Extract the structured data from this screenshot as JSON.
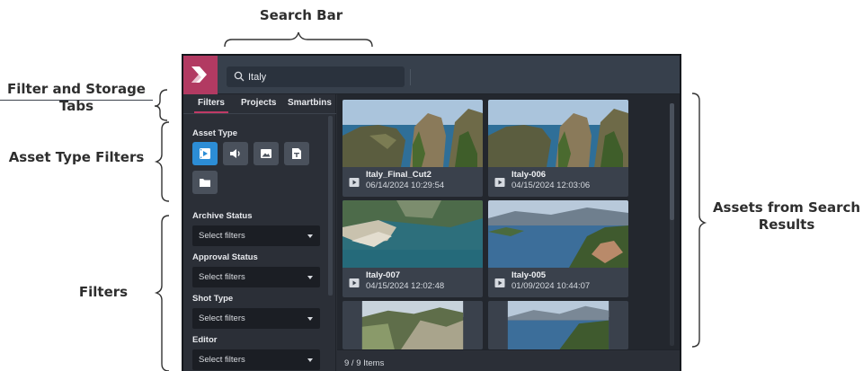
{
  "annotations": {
    "search_bar": "Search Bar",
    "filter_tabs": "Filter and Storage Tabs",
    "asset_type_filters": "Asset Type Filters",
    "filters": "Filters",
    "assets": "Assets from Search Results"
  },
  "search": {
    "value": "Italy",
    "icon": "search-icon"
  },
  "tabs": [
    {
      "label": "Filters",
      "active": true
    },
    {
      "label": "Projects",
      "active": false
    },
    {
      "label": "Smartbins",
      "active": false
    }
  ],
  "sidebar": {
    "asset_type_label": "Asset Type",
    "asset_types": [
      {
        "icon": "video-icon",
        "active": true
      },
      {
        "icon": "audio-icon",
        "active": false
      },
      {
        "icon": "image-icon",
        "active": false
      },
      {
        "icon": "document-icon",
        "active": false
      },
      {
        "icon": "folder-icon",
        "active": false
      }
    ],
    "filters": [
      {
        "label": "Archive Status",
        "placeholder": "Select filters"
      },
      {
        "label": "Approval Status",
        "placeholder": "Select filters"
      },
      {
        "label": "Shot Type",
        "placeholder": "Select filters"
      },
      {
        "label": "Editor",
        "placeholder": "Select filters"
      }
    ]
  },
  "assets": [
    {
      "name": "Italy_Final_Cut2",
      "date": "06/14/2024 10:29:54"
    },
    {
      "name": "Italy-006",
      "date": "04/15/2024 12:03:06"
    },
    {
      "name": "Italy-007",
      "date": "04/15/2024 12:02:48"
    },
    {
      "name": "Italy-005",
      "date": "01/09/2024 10:44:07"
    },
    {
      "name": "",
      "date": ""
    },
    {
      "name": "",
      "date": ""
    }
  ],
  "footer": {
    "count": "9 / 9 Items"
  },
  "colors": {
    "brand": "#b23a62",
    "active_filter": "#2c8dd6",
    "panel": "#2b2f37"
  }
}
